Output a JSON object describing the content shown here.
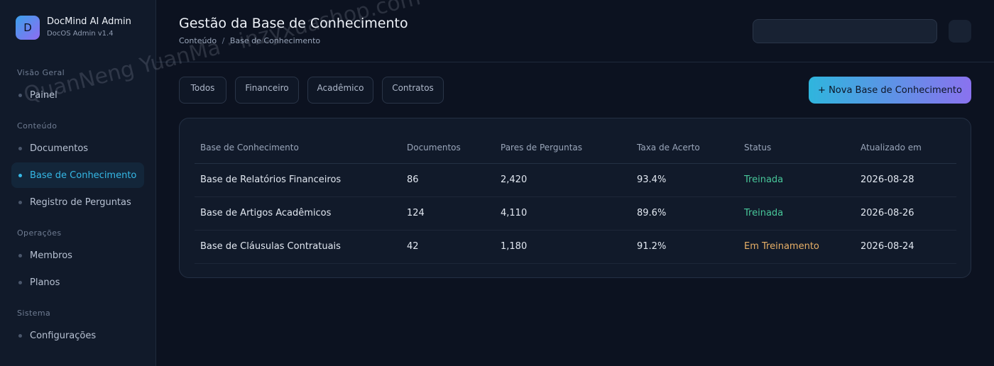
{
  "brand": {
    "logo_letter": "D",
    "title": "DocMind AI Admin",
    "subtitle": "DocOS Admin v1.4"
  },
  "sidebar": {
    "sections": [
      {
        "label": "Visão Geral",
        "items": [
          {
            "label": "Painel",
            "active": false
          }
        ]
      },
      {
        "label": "Conteúdo",
        "items": [
          {
            "label": "Documentos",
            "active": false
          },
          {
            "label": "Base de Conhecimento",
            "active": true
          },
          {
            "label": "Registro de Perguntas",
            "active": false
          }
        ]
      },
      {
        "label": "Operações",
        "items": [
          {
            "label": "Membros",
            "active": false
          },
          {
            "label": "Planos",
            "active": false
          }
        ]
      },
      {
        "label": "Sistema",
        "items": [
          {
            "label": "Configurações",
            "active": false
          }
        ]
      }
    ]
  },
  "header": {
    "title": "Gestão da Base de Conhecimento",
    "breadcrumb": [
      "Conteúdo",
      "Base de Conhecimento"
    ],
    "breadcrumb_sep": "/"
  },
  "filters": [
    "Todos",
    "Financeiro",
    "Acadêmico",
    "Contratos"
  ],
  "new_button_label": "+ Nova Base de Conhecimento",
  "table": {
    "columns": [
      "Base de Conhecimento",
      "Documentos",
      "Pares de Perguntas",
      "Taxa de Acerto",
      "Status",
      "Atualizado em"
    ],
    "rows": [
      {
        "name": "Base de Relatórios Financeiros",
        "documents": "86",
        "pairs": "2,420",
        "accuracy": "93.4%",
        "status": "Treinada",
        "status_type": "trained",
        "updated": "2026-08-28"
      },
      {
        "name": "Base de Artigos Acadêmicos",
        "documents": "124",
        "pairs": "4,110",
        "accuracy": "89.6%",
        "status": "Treinada",
        "status_type": "trained",
        "updated": "2026-08-26"
      },
      {
        "name": "Base de Cláusulas Contratuais",
        "documents": "42",
        "pairs": "1,180",
        "accuracy": "91.2%",
        "status": "Em Treinamento",
        "status_type": "training",
        "updated": "2026-08-24"
      }
    ]
  },
  "watermark": "QuanNeng YuanMa · inzyxuashop.com",
  "colors": {
    "accent": "#35b8e6",
    "trained": "#48c79a",
    "training": "#e8b067",
    "background": "#0c1220"
  }
}
